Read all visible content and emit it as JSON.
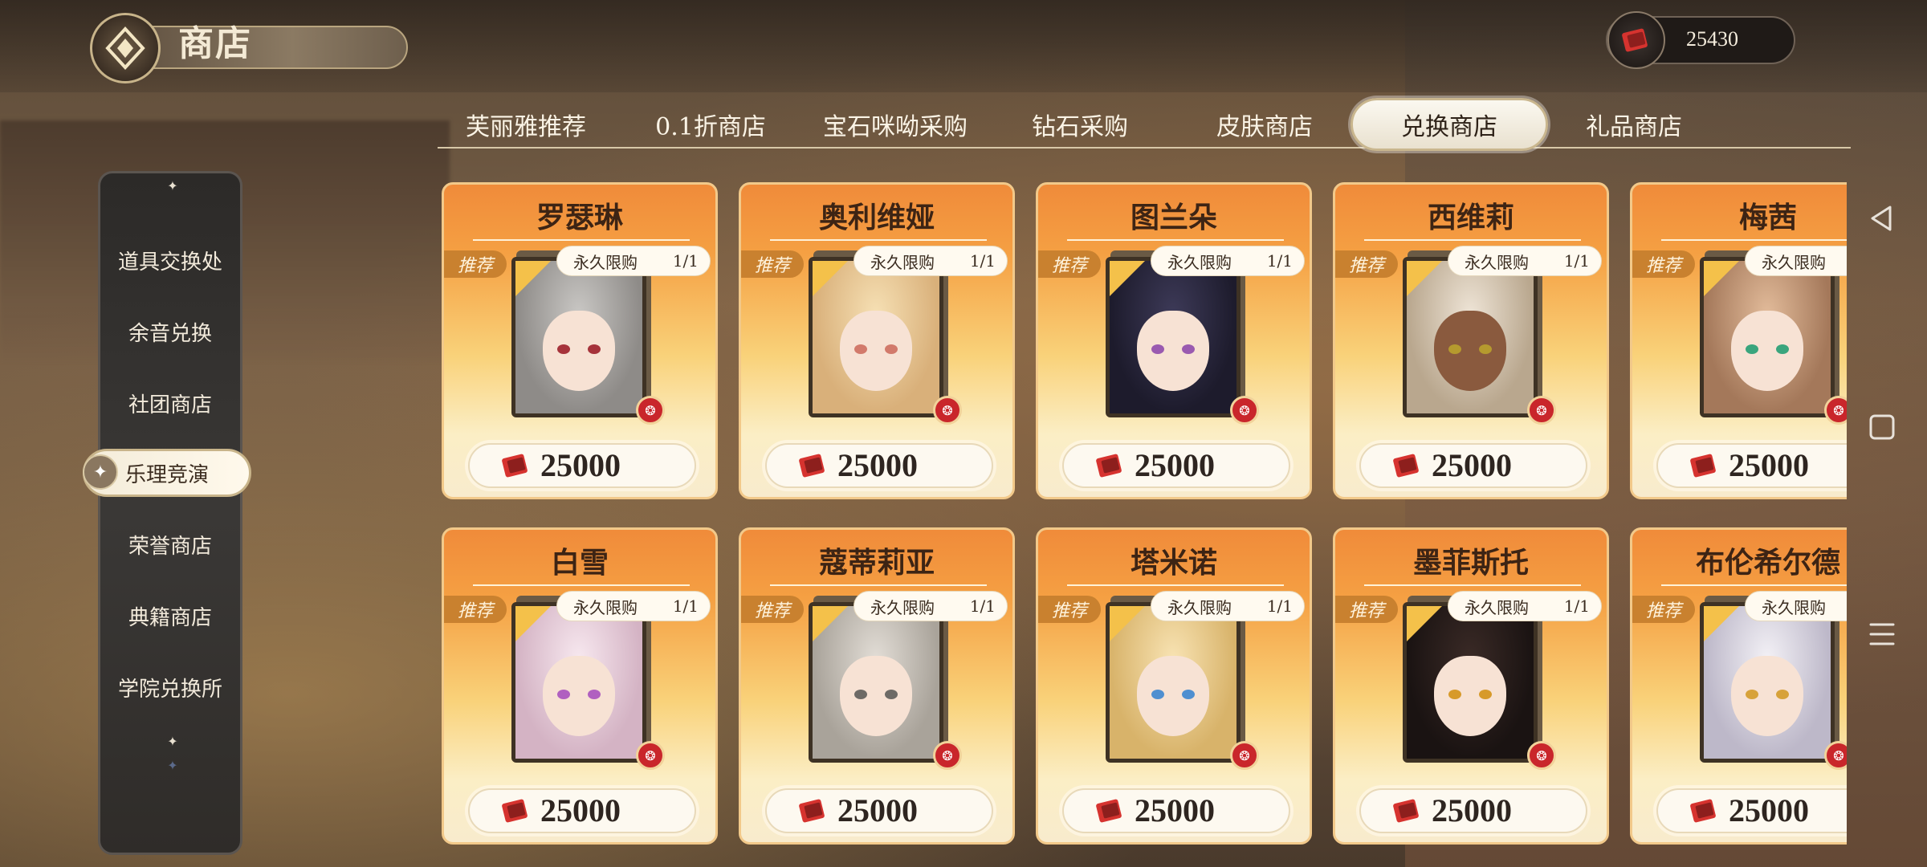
{
  "header": {
    "title": "商店"
  },
  "currency": {
    "amount": "25430",
    "icon": "red-book-icon"
  },
  "tabs": [
    {
      "label": "芙丽雅推荐",
      "active": false
    },
    {
      "label": "0.1折商店",
      "active": false
    },
    {
      "label": "宝石咪呦采购",
      "active": false
    },
    {
      "label": "钻石采购",
      "active": false
    },
    {
      "label": "皮肤商店",
      "active": false
    },
    {
      "label": "兑换商店",
      "active": true
    },
    {
      "label": "礼品商店",
      "active": false
    }
  ],
  "sidebar": {
    "items": [
      {
        "label": "道具交换处",
        "active": false
      },
      {
        "label": "余音兑换",
        "active": false
      },
      {
        "label": "社团商店",
        "active": false
      },
      {
        "label": "乐理竞演",
        "active": true
      },
      {
        "label": "荣誉商店",
        "active": false
      },
      {
        "label": "典籍商店",
        "active": false
      },
      {
        "label": "学院兑换所",
        "active": false
      }
    ]
  },
  "card_common": {
    "badge": "推荐",
    "limit_label": "永久限购",
    "limit_count": "1/1"
  },
  "cards": [
    {
      "name": "罗瑟琳",
      "price": "25000",
      "hair": "#c9c7c4",
      "eyes": "#a6333b"
    },
    {
      "name": "奥利维娅",
      "price": "25000",
      "hair": "#f1d3a2",
      "eyes": "#d27a6b"
    },
    {
      "name": "图兰朵",
      "price": "25000",
      "hair": "#2b2a40",
      "eyes": "#9a5ab0"
    },
    {
      "name": "西维莉",
      "price": "25000",
      "hair": "#e8dccb",
      "eyes": "#b59a2e"
    },
    {
      "name": "梅茜",
      "price": "25000",
      "hair": "#d6a887",
      "eyes": "#3aa57d"
    },
    {
      "name": "白雪",
      "price": "25000",
      "hair": "#f2dde6",
      "eyes": "#b060c0"
    },
    {
      "name": "蔻蒂莉亚",
      "price": "25000",
      "hair": "#d8d4cf",
      "eyes": "#6d6a66"
    },
    {
      "name": "塔米诺",
      "price": "25000",
      "hair": "#f4d79b",
      "eyes": "#4f8fd0"
    },
    {
      "name": "墨菲斯托",
      "price": "25000",
      "hair": "#2a1f1e",
      "eyes": "#d79a2a"
    },
    {
      "name": "布伦希尔德",
      "price": "25000",
      "hair": "#ece9ef",
      "eyes": "#d7a23a"
    }
  ],
  "nav": {
    "back": "triangle-back-icon",
    "home": "square-home-icon",
    "menu": "hamburger-menu-icon"
  }
}
